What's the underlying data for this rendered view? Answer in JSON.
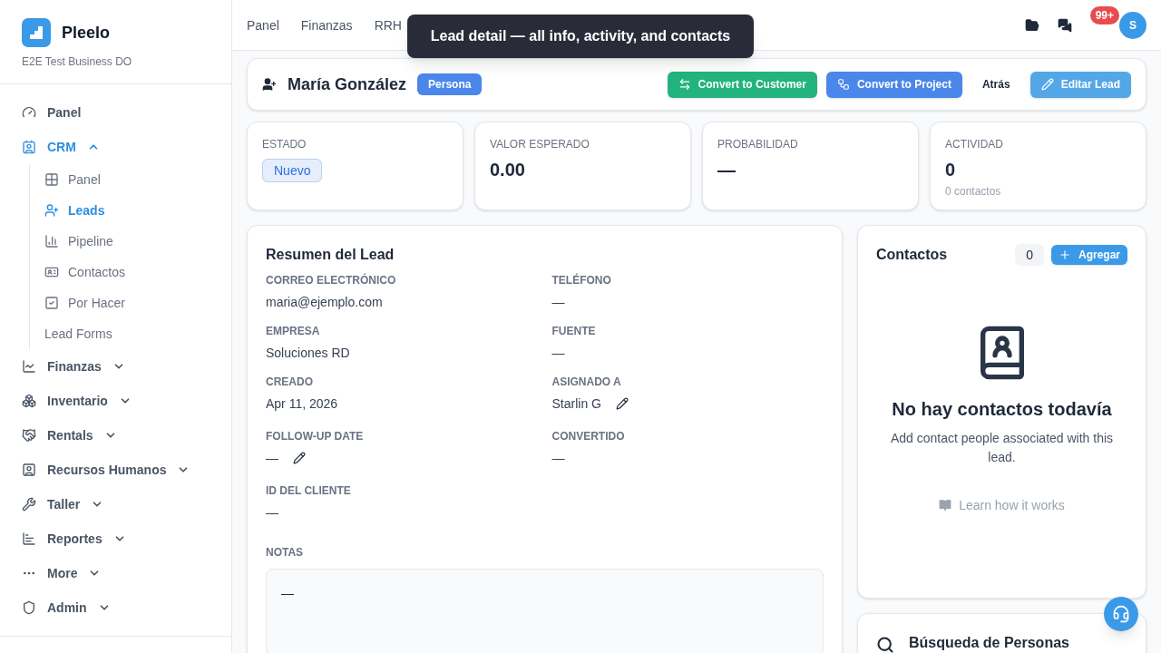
{
  "brand": {
    "name": "Pleelo",
    "subtitle": "E2E Test Business DO"
  },
  "sidebar": {
    "items": [
      {
        "label": "Panel",
        "selected": false
      },
      {
        "label": "CRM",
        "selected": true,
        "expanded": true,
        "children": [
          {
            "label": "Panel",
            "selected": false
          },
          {
            "label": "Leads",
            "selected": true
          },
          {
            "label": "Pipeline",
            "selected": false
          },
          {
            "label": "Contactos",
            "selected": false
          },
          {
            "label": "Por Hacer",
            "selected": false
          },
          {
            "label": "Lead Forms",
            "selected": false
          }
        ]
      },
      {
        "label": "Finanzas",
        "selected": false,
        "expanded": false
      },
      {
        "label": "Inventario",
        "selected": false,
        "expanded": false
      },
      {
        "label": "Rentals",
        "selected": false,
        "expanded": false
      },
      {
        "label": "Recursos Humanos",
        "selected": false,
        "expanded": false
      },
      {
        "label": "Taller",
        "selected": false,
        "expanded": false
      },
      {
        "label": "Reportes",
        "selected": false,
        "expanded": false
      },
      {
        "label": "More",
        "selected": false,
        "expanded": false
      },
      {
        "label": "Admin",
        "selected": false,
        "expanded": false
      }
    ]
  },
  "topnav": {
    "items": [
      "Panel",
      "Finanzas",
      "RRH"
    ],
    "tooltip": "Lead detail — all info, activity, and contacts",
    "notification_badge": "99+",
    "avatar": "S"
  },
  "header": {
    "name": "María González",
    "tag": "Persona",
    "buttons": [
      {
        "label": "Convert to Customer",
        "kind": "success"
      },
      {
        "label": "Convert to Project",
        "kind": "primary"
      },
      {
        "label": "Atrás",
        "kind": "ghost"
      },
      {
        "label": "Editar Lead",
        "kind": "secondary"
      }
    ]
  },
  "stats": [
    {
      "label": "ESTADO",
      "kind": "badge",
      "value": "Nuevo"
    },
    {
      "label": "VALOR ESPERADO",
      "kind": "value",
      "value": "0.00"
    },
    {
      "label": "PROBABILIDAD",
      "kind": "value",
      "value": "—"
    },
    {
      "label": "ACTIVIDAD",
      "kind": "value",
      "value": "0",
      "note": "0 contactos"
    }
  ],
  "summary": {
    "title": "Resumen del Lead",
    "fields": [
      {
        "label": "CORREO ELECTRÓNICO",
        "value": "maria@ejemplo.com",
        "editable": false
      },
      {
        "label": "TELÉFONO",
        "value": "—",
        "editable": false
      },
      {
        "label": "EMPRESA",
        "value": "Soluciones RD",
        "editable": false
      },
      {
        "label": "FUENTE",
        "value": "—",
        "editable": false
      },
      {
        "label": "CREADO",
        "value": "Apr 11, 2026",
        "editable": false
      },
      {
        "label": "ASIGNADO A",
        "value": "Starlin G",
        "editable": true
      },
      {
        "label": "FOLLOW-UP DATE",
        "value": "—",
        "editable": true
      },
      {
        "label": "CONVERTIDO",
        "value": "—",
        "editable": false
      },
      {
        "label": "ID DEL CLIENTE",
        "value": "—",
        "editable": false
      }
    ],
    "notes_label": "NOTAS",
    "notes": "—"
  },
  "contacts": {
    "title": "Contactos",
    "count": "0",
    "add_button": "Agregar",
    "empty_title": "No hay contactos todavía",
    "empty_text": "Add contact people associated with this lead.",
    "help_link": "Learn how it works"
  },
  "people_search": {
    "title": "Búsqueda de Personas"
  }
}
